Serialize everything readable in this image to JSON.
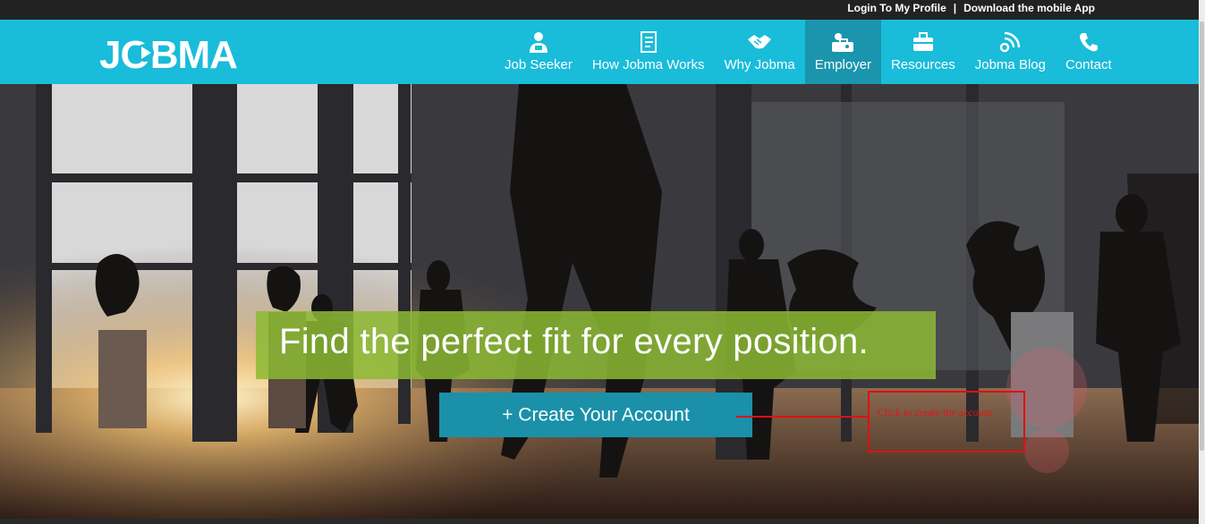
{
  "topbar": {
    "login_link": "Login To My Profile",
    "separator": "|",
    "download_link": "Download the mobile App"
  },
  "brand": {
    "logo_text": "JOBMA",
    "primary_color": "#19bcd9",
    "active_color": "#1a95ad"
  },
  "nav": {
    "items": [
      {
        "label": "Job Seeker",
        "icon": "job-seeker-icon"
      },
      {
        "label": "How Jobma Works",
        "icon": "document-icon"
      },
      {
        "label": "Why Jobma",
        "icon": "handshake-icon"
      },
      {
        "label": "Employer",
        "icon": "employer-icon",
        "active": true
      },
      {
        "label": "Resources",
        "icon": "briefcase-icon"
      },
      {
        "label": "Jobma Blog",
        "icon": "rss-icon"
      },
      {
        "label": "Contact",
        "icon": "phone-icon"
      }
    ]
  },
  "hero": {
    "headline": "Find the perfect fit for every position.",
    "cta_label": "+ Create Your Account",
    "headline_bg": "#8cba34",
    "cta_bg": "#1a91a9"
  },
  "annotation": {
    "text": "Click to create the account",
    "color": "#e01010"
  }
}
